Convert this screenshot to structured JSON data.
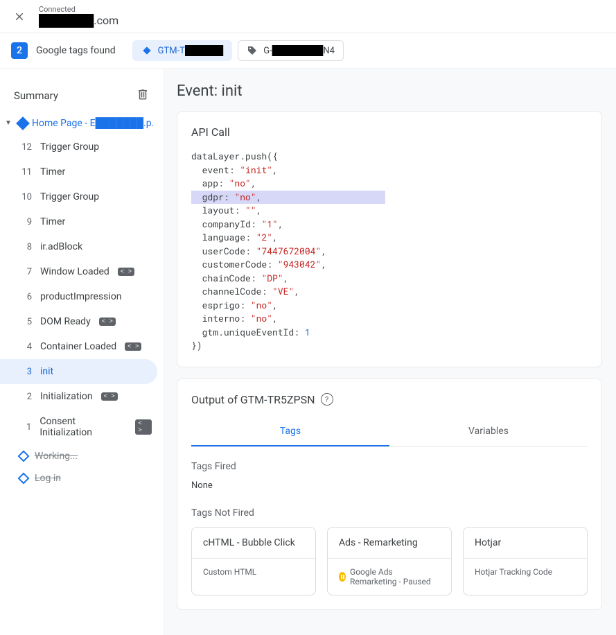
{
  "header": {
    "connected_label": "Connected",
    "domain_prefix": "███████",
    "domain_suffix": ".com"
  },
  "tags_bar": {
    "count": "2",
    "found_label": "Google tags found",
    "chip1_prefix": "GTM-T",
    "chip1_redact": "██████",
    "chip2_prefix": "G-",
    "chip2_redact": "████████",
    "chip2_suffix": "N4"
  },
  "sidebar": {
    "summary_label": "Summary",
    "page_label": "Home Page - E███████.p.",
    "events": [
      {
        "num": "12",
        "name": "Trigger Group",
        "badge": false
      },
      {
        "num": "11",
        "name": "Timer",
        "badge": false
      },
      {
        "num": "10",
        "name": "Trigger Group",
        "badge": false
      },
      {
        "num": "9",
        "name": "Timer",
        "badge": false
      },
      {
        "num": "8",
        "name": "ir.adBlock",
        "badge": false
      },
      {
        "num": "7",
        "name": "Window Loaded",
        "badge": true
      },
      {
        "num": "6",
        "name": "productImpression",
        "badge": false
      },
      {
        "num": "5",
        "name": "DOM Ready",
        "badge": true
      },
      {
        "num": "4",
        "name": "Container Loaded",
        "badge": true
      },
      {
        "num": "3",
        "name": "init",
        "badge": false,
        "selected": true
      },
      {
        "num": "2",
        "name": "Initialization",
        "badge": true
      },
      {
        "num": "1",
        "name": "Consent Initialization",
        "badge": true
      }
    ],
    "working_label": "Working...",
    "login_label": "Log in"
  },
  "main": {
    "title": "Event: init",
    "api_call_label": "API Call",
    "output_label": "Output of GTM-TR5ZPSN",
    "tabs": {
      "tags": "Tags",
      "variables": "Variables"
    },
    "tags_fired_label": "Tags Fired",
    "none_label": "None",
    "tags_not_fired_label": "Tags Not Fired",
    "cards": [
      {
        "title": "cHTML - Bubble Click",
        "sub": "Custom HTML",
        "paused": false
      },
      {
        "title": "Ads - Remarketing",
        "sub": "Google Ads Remarketing - Paused",
        "paused": true
      },
      {
        "title": "Hotjar",
        "sub": "Hotjar Tracking Code",
        "paused": false
      }
    ]
  },
  "api_call": {
    "line1": "dataLayer.push({",
    "event_key": "event",
    "event_val": "\"init\"",
    "app_key": "app",
    "app_val": "\"no\"",
    "gdpr_key": "gdpr",
    "gdpr_val": "\"no\"",
    "layout_key": "layout",
    "layout_val": "\"\"",
    "companyId_key": "companyId",
    "companyId_val": "\"1\"",
    "language_key": "language",
    "language_val": "\"2\"",
    "userCode_key": "userCode",
    "userCode_val": "\"7447672004\"",
    "customerCode_key": "customerCode",
    "customerCode_val": "\"943042\"",
    "chainCode_key": "chainCode",
    "chainCode_val": "\"DP\"",
    "channelCode_key": "channelCode",
    "channelCode_val": "\"VE\"",
    "esprigo_key": "esprigo",
    "esprigo_val": "\"no\"",
    "interno_key": "interno",
    "interno_val": "\"no\"",
    "gtm_key": "gtm.uniqueEventId",
    "gtm_val": "1",
    "close": "})"
  }
}
